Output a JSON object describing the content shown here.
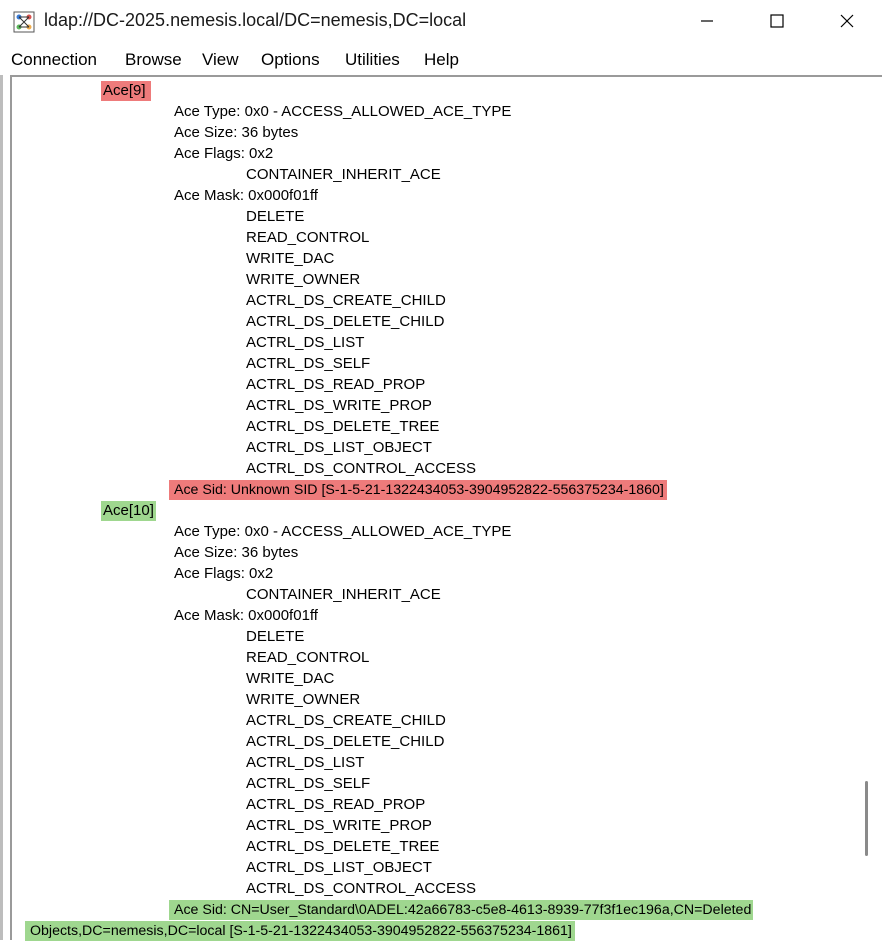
{
  "window": {
    "title": "ldap://DC-2025.nemesis.local/DC=nemesis,DC=local",
    "icon": "ldp-app-icon",
    "controls": [
      "minimize-icon",
      "maximize-icon",
      "close-icon"
    ]
  },
  "menu": {
    "items": [
      "Connection",
      "Browse",
      "View",
      "Options",
      "Utilities",
      "Help"
    ]
  },
  "colors": {
    "unknown_sid_highlight": "#ee7b7b",
    "resolved_sid_highlight": "#9fd78f"
  },
  "aces": [
    {
      "header": "Ace[9]",
      "type": "Ace Type:  0x0 - ACCESS_ALLOWED_ACE_TYPE",
      "size": "Ace Size:  36 bytes",
      "flags": "Ace Flags: 0x2",
      "flag_values": [
        "CONTAINER_INHERIT_ACE"
      ],
      "mask": "Ace Mask:  0x000f01ff",
      "mask_values": [
        "DELETE",
        "READ_CONTROL",
        "WRITE_DAC",
        "WRITE_OWNER",
        "ACTRL_DS_CREATE_CHILD",
        "ACTRL_DS_DELETE_CHILD",
        "ACTRL_DS_LIST",
        "ACTRL_DS_SELF",
        "ACTRL_DS_READ_PROP",
        "ACTRL_DS_WRITE_PROP",
        "ACTRL_DS_DELETE_TREE",
        "ACTRL_DS_LIST_OBJECT",
        "ACTRL_DS_CONTROL_ACCESS"
      ],
      "sid": "Ace Sid:   Unknown SID [S-1-5-21-1322434053-3904952822-556375234-1860]"
    },
    {
      "header": "Ace[10]",
      "type": "Ace Type:  0x0 - ACCESS_ALLOWED_ACE_TYPE",
      "size": "Ace Size:  36 bytes",
      "flags": "Ace Flags: 0x2",
      "flag_values": [
        "CONTAINER_INHERIT_ACE"
      ],
      "mask": "Ace Mask:  0x000f01ff",
      "mask_values": [
        "DELETE",
        "READ_CONTROL",
        "WRITE_DAC",
        "WRITE_OWNER",
        "ACTRL_DS_CREATE_CHILD",
        "ACTRL_DS_DELETE_CHILD",
        "ACTRL_DS_LIST",
        "ACTRL_DS_SELF",
        "ACTRL_DS_READ_PROP",
        "ACTRL_DS_WRITE_PROP",
        "ACTRL_DS_DELETE_TREE",
        "ACTRL_DS_LIST_OBJECT",
        "ACTRL_DS_CONTROL_ACCESS"
      ],
      "sid": "Ace Sid:   CN=User_Standard\\0ADEL:42a66783-c5e8-4613-8939-77f3f1ec196a,CN=Deleted",
      "sid_continuation": "Objects,DC=nemesis,DC=local [S-1-5-21-1322434053-3904952822-556375234-1861]"
    }
  ]
}
